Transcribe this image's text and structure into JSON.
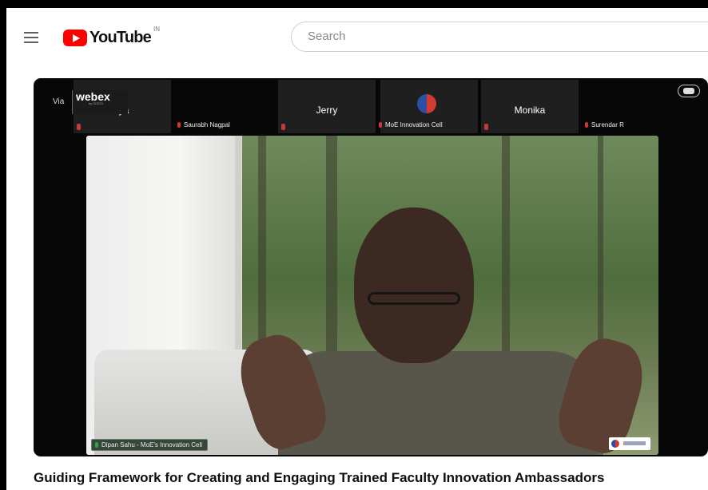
{
  "header": {
    "logo_text": "YouTube",
    "country_code": "IN",
    "search_placeholder": "Search"
  },
  "video": {
    "via_text": "Via",
    "webex_logo": "webex",
    "webex_sub": "by CISCO",
    "participants": [
      {
        "name": "lasariya"
      },
      {
        "name": "Jerry"
      },
      {
        "name": ""
      },
      {
        "name": "Monika"
      }
    ],
    "strip_labels": [
      "Saurabh Nagpal",
      "MoE Innovation Cell",
      "Surendar R"
    ],
    "active_speaker": "Dipan Sahu - MoE's Innovation Cell",
    "colors": {
      "mic_muted": "#c43a3a",
      "mic_active": "#2fa34a"
    }
  },
  "title": "Guiding Framework for Creating and Engaging Trained Faculty Innovation Ambassadors"
}
